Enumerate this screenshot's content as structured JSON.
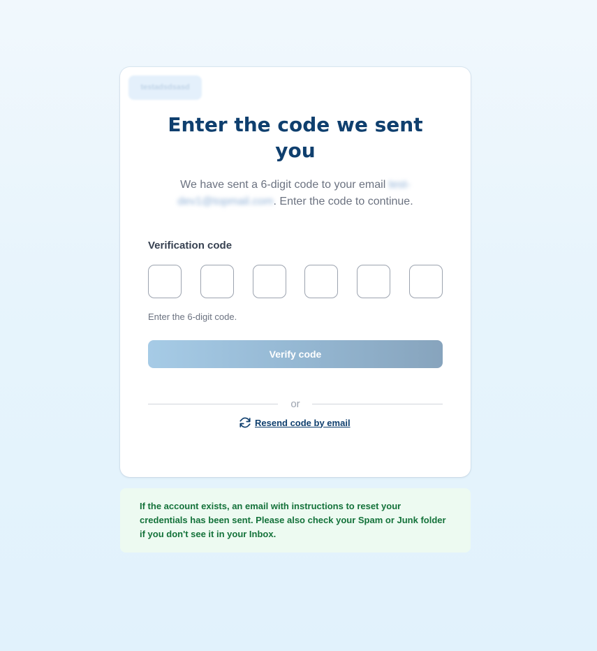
{
  "card": {
    "badge_text": "testadsdsasd",
    "title": "Enter the code we sent you",
    "subtitle_prefix": "We have sent a 6-digit code to your email ",
    "email": "test-dev1@topmail.com",
    "subtitle_suffix": ". Enter the code to continue.",
    "field_label": "Verification code",
    "code_digits": [
      "",
      "",
      "",
      "",
      "",
      ""
    ],
    "hint": "Enter the 6-digit code.",
    "verify_label": "Verify code",
    "or_label": "or",
    "resend_label": "Resend code by email"
  },
  "alert": {
    "message": "If the account exists, an email with instructions to reset your credentials has been sent. Please also check your Spam or Junk folder if you don't see it in your Inbox."
  },
  "colors": {
    "title": "#0f3f6e",
    "alert_text": "#14723a",
    "alert_background": "#edfaf1"
  },
  "icons": {
    "resend": "refresh-icon"
  }
}
